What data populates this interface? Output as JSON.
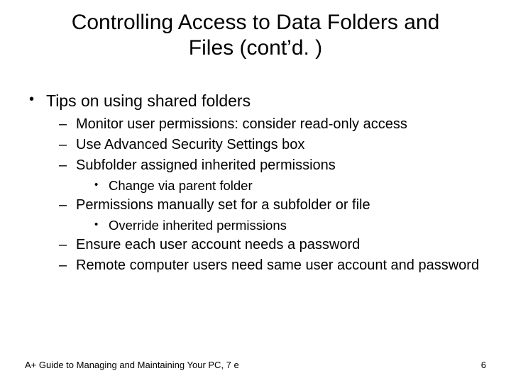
{
  "title_line1": "Controlling Access to Data Folders and",
  "title_line2": "Files (cont’d. )",
  "bullets": {
    "l1_0": "Tips on using shared folders",
    "l2_0": "Monitor user permissions: consider read-only access",
    "l2_1": "Use Advanced Security Settings box",
    "l2_2": "Subfolder assigned inherited permissions",
    "l3_0": "Change via parent folder",
    "l2_3": "Permissions manually set for a subfolder or file",
    "l3_1": "Override inherited permissions",
    "l2_4": "Ensure each user account needs a password",
    "l2_5": "Remote computer users need same user account and password"
  },
  "footer": {
    "left": "A+ Guide to Managing and Maintaining Your PC, 7 e",
    "page": "6"
  }
}
